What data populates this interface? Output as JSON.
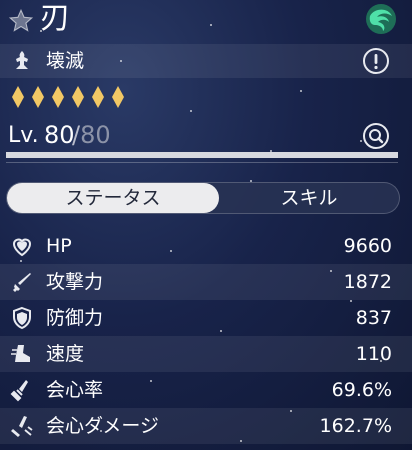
{
  "character": {
    "name": "刃",
    "path": "壊滅",
    "rarity_stars": 6,
    "element_color": "#2fb88a"
  },
  "level": {
    "label": "Lv.",
    "current": "80",
    "max": "80",
    "separator": "/",
    "progress": 1.0
  },
  "tabs": [
    {
      "label": "ステータス",
      "active": true
    },
    {
      "label": "スキル",
      "active": false
    }
  ],
  "stats": [
    {
      "icon": "heart-icon",
      "label": "HP",
      "value": "9660"
    },
    {
      "icon": "sword-icon",
      "label": "攻撃力",
      "value": "1872"
    },
    {
      "icon": "shield-icon",
      "label": "防御力",
      "value": "837"
    },
    {
      "icon": "boot-icon",
      "label": "速度",
      "value": "110"
    },
    {
      "icon": "crit-rate-icon",
      "label": "会心率",
      "value": "69.6%"
    },
    {
      "icon": "crit-damage-icon",
      "label": "会心ダメージ",
      "value": "162.7%"
    }
  ],
  "colors": {
    "accent_gold": "#f2c865",
    "tab_active_bg": "#ececee",
    "tab_active_text": "#22283a"
  }
}
